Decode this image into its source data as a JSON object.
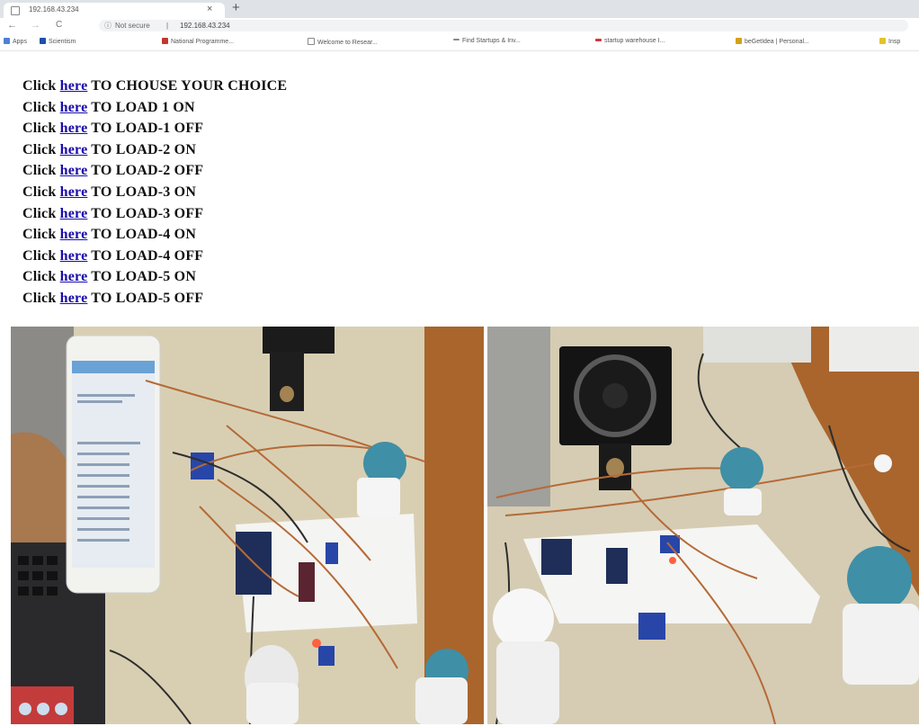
{
  "browser": {
    "tab_title": "192.168.43.234",
    "tab_close": "×",
    "new_tab": "+",
    "nav": {
      "back": "←",
      "forward": "→",
      "reload": "C"
    },
    "security_label": "Not secure",
    "separator": "|",
    "url": "192.168.43.234",
    "bookmarks": [
      {
        "label": "Apps",
        "color": "#4f7fd6"
      },
      {
        "label": "Scientism",
        "color": "#1f4fa8"
      },
      {
        "label": "National Programme...",
        "color": "#c0392b"
      },
      {
        "label": "Welcome to Resear...",
        "color": "#ffffff"
      },
      {
        "label": "Find Startups & Inv...",
        "color": "#888888"
      },
      {
        "label": "startup warehouse I...",
        "color": "#d6343a"
      },
      {
        "label": "beGetIdea | Personal...",
        "color": "#d4a017"
      },
      {
        "label": "Insp",
        "color": "#e6c229"
      }
    ]
  },
  "page": {
    "lines": [
      {
        "prefix": "Click",
        "link": "here",
        "suffix": "TO CHOUSE YOUR CHOICE"
      },
      {
        "prefix": "Click",
        "link": "here",
        "suffix": "TO LOAD 1 ON"
      },
      {
        "prefix": "Click",
        "link": "here",
        "suffix": "TO LOAD-1 OFF"
      },
      {
        "prefix": "Click",
        "link": "here",
        "suffix": "TO LOAD-2 ON"
      },
      {
        "prefix": "Click",
        "link": "here",
        "suffix": "TO LOAD-2 OFF"
      },
      {
        "prefix": "Click",
        "link": "here",
        "suffix": "TO LOAD-3 ON"
      },
      {
        "prefix": "Click",
        "link": "here",
        "suffix": "TO LOAD-3 OFF"
      },
      {
        "prefix": "Click",
        "link": "here",
        "suffix": "TO LOAD-4 ON"
      },
      {
        "prefix": "Click",
        "link": "here",
        "suffix": "TO LOAD-4 OFF"
      },
      {
        "prefix": "Click",
        "link": "here",
        "suffix": "TO LOAD-5 ON"
      },
      {
        "prefix": "Click",
        "link": "here",
        "suffix": "TO LOAD-5 OFF"
      }
    ]
  },
  "colors": {
    "link": "#1a0dab",
    "bulb_blue": "#3f8fa6",
    "relay_blue": "#2846a8",
    "desk": "#d9cfb2",
    "styrofoam": "#f4f4f2"
  }
}
